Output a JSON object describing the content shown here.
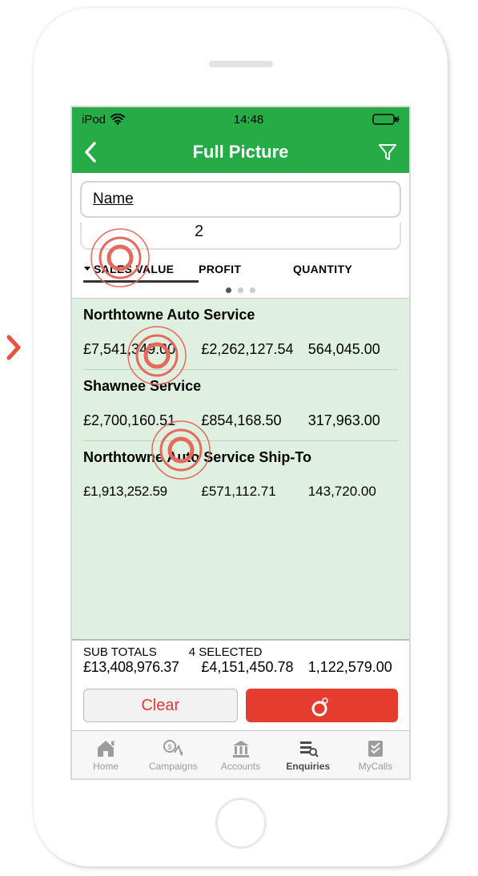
{
  "status": {
    "device": "iPod",
    "time": "14:48"
  },
  "nav": {
    "title": "Full Picture"
  },
  "search": {
    "label": "Name"
  },
  "partial_value": "2",
  "columns": {
    "sales": "SALES VALUE",
    "profit": "PROFIT",
    "quantity": "QUANTITY"
  },
  "rows": [
    {
      "name": "Northtowne Auto Service",
      "sales": "£7,541,349.00",
      "profit": "£2,262,127.54",
      "quantity": "564,045.00"
    },
    {
      "name": "Shawnee Service",
      "sales": "£2,700,160.51",
      "profit": "£854,168.50",
      "quantity": "317,963.00"
    },
    {
      "name": "Northtowne Auto Service Ship-To",
      "sales": "£1,913,252.59",
      "profit": "£571,112.71",
      "quantity": "143,720.00"
    }
  ],
  "subtotals": {
    "label": "SUB TOTALS",
    "selected": "4 SELECTED",
    "sales": "£13,408,976.37",
    "profit": "£4,151,450.78",
    "quantity": "1,122,579.00"
  },
  "buttons": {
    "clear": "Clear"
  },
  "tabs": {
    "home": "Home",
    "campaigns": "Campaigns",
    "accounts": "Accounts",
    "enquiries": "Enquiries",
    "mycalls": "MyCalls"
  },
  "colors": {
    "brand_green": "#25AC46",
    "action_red": "#E43D30"
  }
}
